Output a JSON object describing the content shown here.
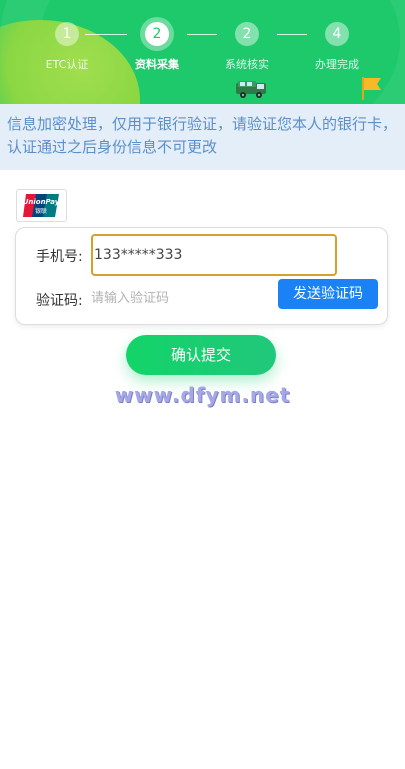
{
  "steps": [
    {
      "num": "1",
      "label": "ETC认证",
      "active": false
    },
    {
      "num": "2",
      "label": "资料采集",
      "active": true
    },
    {
      "num": "2",
      "label": "系统核实",
      "active": false
    },
    {
      "num": "4",
      "label": "办理完成",
      "active": false
    }
  ],
  "notice": "信息加密处理，仅用于银行验证，请验证您本人的银行卡，认证通过之后身份信息不可更改",
  "unionpay": {
    "line1": "UnionPay",
    "line2": "银联"
  },
  "form": {
    "phone_label": "手机号:",
    "phone_value": "133*****333",
    "code_label": "验证码:",
    "code_placeholder": "请输入验证码",
    "send_code_label": "发送验证码"
  },
  "submit_label": "确认提交",
  "watermark": "www.dfym.net",
  "colors": {
    "header_green": "#1ec96b",
    "send_blue": "#1a82f5",
    "notice_text": "#5b8fc9"
  }
}
